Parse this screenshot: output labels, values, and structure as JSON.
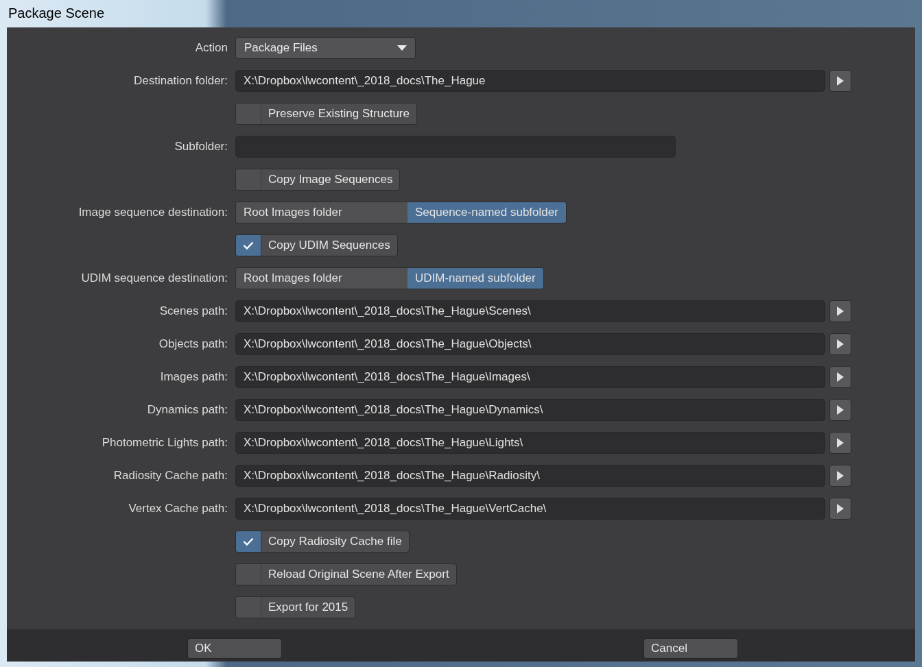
{
  "window": {
    "title": "Package Scene"
  },
  "rows": [
    {
      "kind": "dropdown",
      "label": "Action",
      "value": "Package Files"
    },
    {
      "kind": "path",
      "label": "Destination folder:",
      "value": "X:\\Dropbox\\lwcontent\\_2018_docs\\The_Hague"
    },
    {
      "kind": "checkbox",
      "text": "Preserve Existing Structure",
      "checked": false
    },
    {
      "kind": "text",
      "label": "Subfolder:"
    },
    {
      "kind": "checkbox",
      "text": "Copy Image Sequences",
      "checked": false
    },
    {
      "kind": "choice",
      "label": "Image sequence destination:",
      "options": [
        {
          "label": "Root Images folder",
          "selected": false
        },
        {
          "label": "Sequence-named subfolder",
          "selected": true
        }
      ]
    },
    {
      "kind": "checkbox",
      "text": "Copy UDIM Sequences",
      "checked": true
    },
    {
      "kind": "choice",
      "label": "UDIM sequence destination:",
      "options": [
        {
          "label": "Root Images folder",
          "selected": false
        },
        {
          "label": "UDIM-named subfolder",
          "selected": true
        }
      ]
    },
    {
      "kind": "path",
      "label": "Scenes path:",
      "value": "X:\\Dropbox\\lwcontent\\_2018_docs\\The_Hague\\Scenes\\"
    },
    {
      "kind": "path",
      "label": "Objects path:",
      "value": "X:\\Dropbox\\lwcontent\\_2018_docs\\The_Hague\\Objects\\"
    },
    {
      "kind": "path",
      "label": "Images path:",
      "value": "X:\\Dropbox\\lwcontent\\_2018_docs\\The_Hague\\Images\\"
    },
    {
      "kind": "path",
      "label": "Dynamics path:",
      "value": "X:\\Dropbox\\lwcontent\\_2018_docs\\The_Hague\\Dynamics\\"
    },
    {
      "kind": "path",
      "label": "Photometric Lights path:",
      "value": "X:\\Dropbox\\lwcontent\\_2018_docs\\The_Hague\\Lights\\"
    },
    {
      "kind": "path",
      "label": "Radiosity Cache path:",
      "value": "X:\\Dropbox\\lwcontent\\_2018_docs\\The_Hague\\Radiosity\\"
    },
    {
      "kind": "path",
      "label": "Vertex Cache path:",
      "value": "X:\\Dropbox\\lwcontent\\_2018_docs\\The_Hague\\VertCache\\"
    },
    {
      "kind": "checkbox",
      "text": "Copy Radiosity Cache file",
      "checked": true
    },
    {
      "kind": "checkbox",
      "text": "Reload Original Scene After Export",
      "checked": false
    },
    {
      "kind": "checkbox",
      "text": "Export for 2015",
      "checked": false
    }
  ],
  "buttons": [
    "OK",
    "Cancel"
  ]
}
